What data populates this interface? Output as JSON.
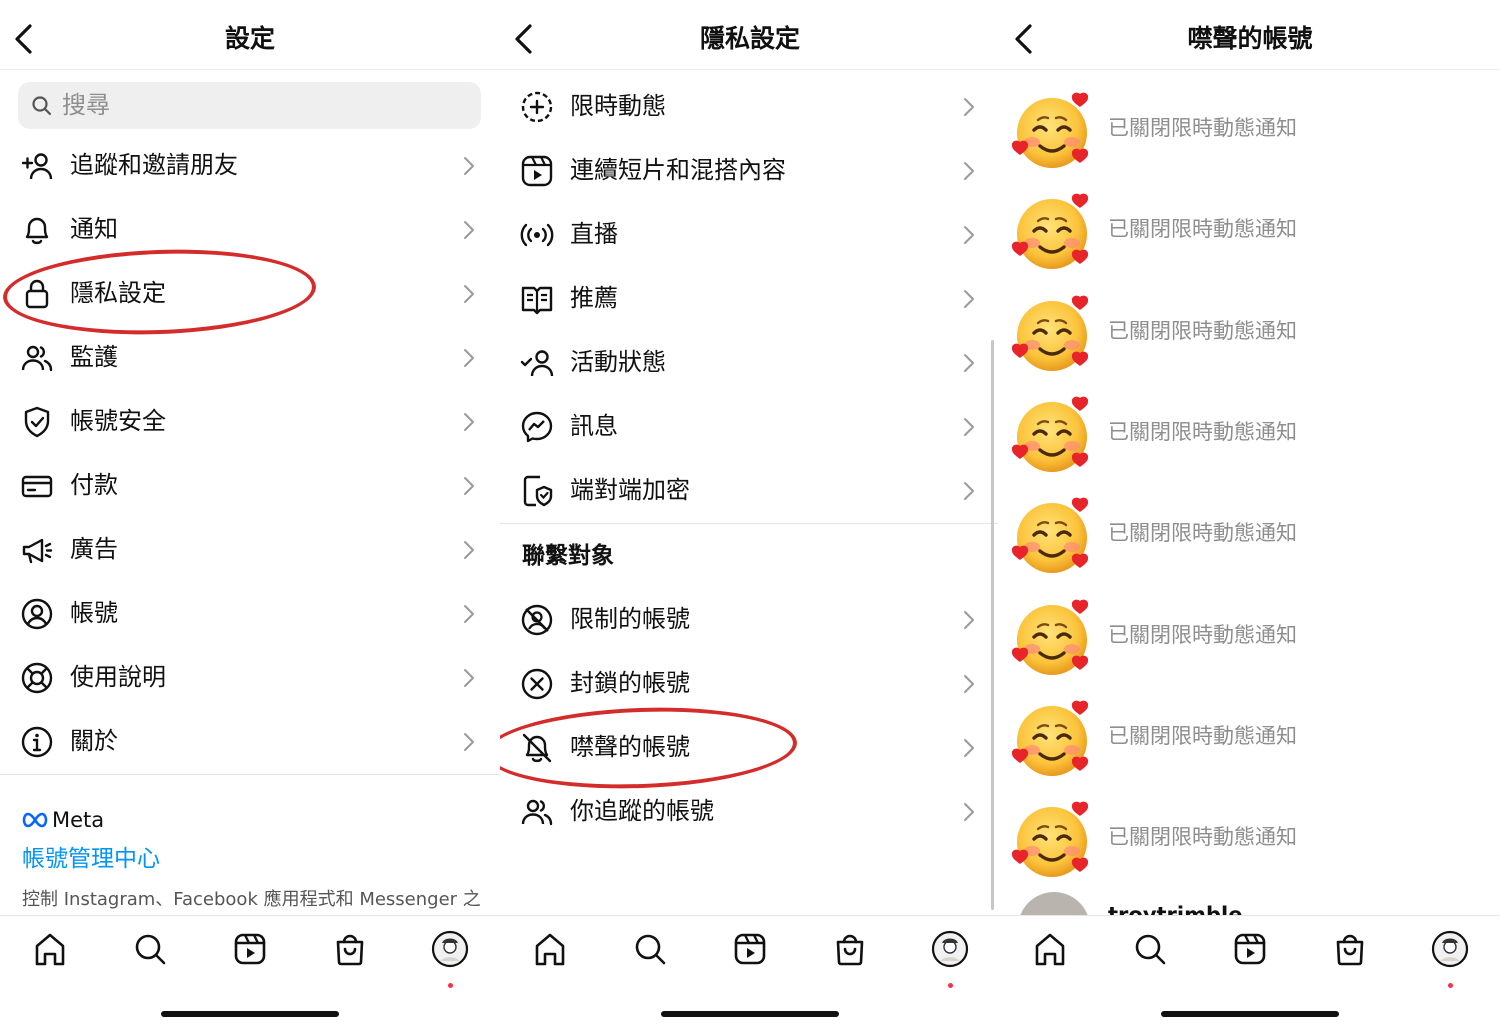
{
  "screen1": {
    "title": "設定",
    "search_placeholder": "搜尋",
    "items": [
      {
        "label": "追蹤和邀請朋友",
        "icon": "add-friend-icon"
      },
      {
        "label": "通知",
        "icon": "bell-icon"
      },
      {
        "label": "隱私設定",
        "icon": "lock-icon"
      },
      {
        "label": "監護",
        "icon": "supervision-icon"
      },
      {
        "label": "帳號安全",
        "icon": "shield-icon"
      },
      {
        "label": "付款",
        "icon": "card-icon"
      },
      {
        "label": "廣告",
        "icon": "megaphone-icon"
      },
      {
        "label": "帳號",
        "icon": "account-icon"
      },
      {
        "label": "使用說明",
        "icon": "lifebuoy-icon"
      },
      {
        "label": "關於",
        "icon": "info-icon"
      }
    ],
    "meta_brand": "Meta",
    "accounts_center": "帳號管理中心",
    "accounts_center_desc": "控制 Instagram、Facebook 應用程式和 Messenger 之"
  },
  "screen2": {
    "title": "隱私設定",
    "items": [
      {
        "label": "限時動態",
        "icon": "story-add-icon"
      },
      {
        "label": "連續短片和混搭內容",
        "icon": "reels-icon"
      },
      {
        "label": "直播",
        "icon": "live-icon"
      },
      {
        "label": "推薦",
        "icon": "guide-icon"
      },
      {
        "label": "活動狀態",
        "icon": "activity-status-icon"
      },
      {
        "label": "訊息",
        "icon": "messenger-icon"
      },
      {
        "label": "端對端加密",
        "icon": "encryption-icon"
      }
    ],
    "section_title": "聯繫對象",
    "section_items": [
      {
        "label": "限制的帳號",
        "icon": "restricted-icon"
      },
      {
        "label": "封鎖的帳號",
        "icon": "blocked-icon"
      },
      {
        "label": "噤聲的帳號",
        "icon": "muted-bell-icon"
      },
      {
        "label": "你追蹤的帳號",
        "icon": "following-icon"
      }
    ]
  },
  "screen3": {
    "title": "噤聲的帳號",
    "rows": [
      {
        "status": "已關閉限時動態通知",
        "avatar": "smiling-face-with-hearts-emoji"
      },
      {
        "status": "已關閉限時動態通知",
        "avatar": "smiling-face-with-hearts-emoji"
      },
      {
        "status": "已關閉限時動態通知",
        "avatar": "smiling-face-with-hearts-emoji"
      },
      {
        "status": "已關閉限時動態通知",
        "avatar": "smiling-face-with-hearts-emoji"
      },
      {
        "status": "已關閉限時動態通知",
        "avatar": "smiling-face-with-hearts-emoji"
      },
      {
        "status": "已關閉限時動態通知",
        "avatar": "smiling-face-with-hearts-emoji"
      },
      {
        "status": "已關閉限時動態通知",
        "avatar": "smiling-face-with-hearts-emoji"
      },
      {
        "status": "已關閉限時動態通知",
        "avatar": "smiling-face-with-hearts-emoji"
      }
    ],
    "partial_username": "troytrimble"
  },
  "tabbar": [
    "home-icon",
    "search-icon",
    "reels-icon",
    "shop-icon",
    "profile-icon"
  ],
  "colors": {
    "highlight": "#d42b2b",
    "link": "#0095f6",
    "muted_text": "#8e8e8e",
    "notification_dot": "#ff3040"
  }
}
